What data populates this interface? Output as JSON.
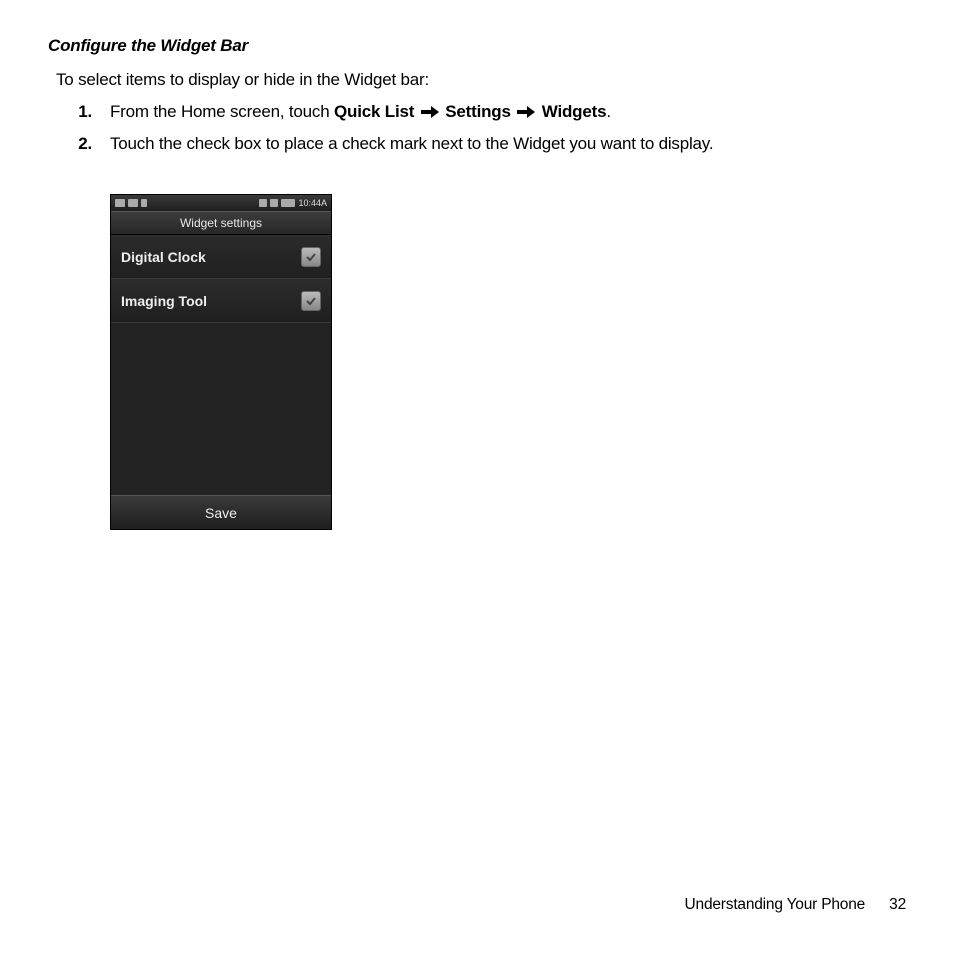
{
  "heading": "Configure the Widget Bar",
  "intro": "To select items to display or hide in the Widget bar:",
  "steps": [
    {
      "num": "1.",
      "prefix": "From the Home screen, touch ",
      "path": [
        "Quick List",
        "Settings",
        "Widgets"
      ],
      "suffix": "."
    },
    {
      "num": "2.",
      "text": "Touch the check box to place a check mark next to the Widget you want to display."
    }
  ],
  "phone": {
    "statusbar_time": "10:44A",
    "title": "Widget settings",
    "list": [
      {
        "label": "Digital Clock",
        "checked": true
      },
      {
        "label": "Imaging Tool",
        "checked": true
      }
    ],
    "save_label": "Save"
  },
  "footer": {
    "section": "Understanding Your Phone",
    "page": "32"
  }
}
